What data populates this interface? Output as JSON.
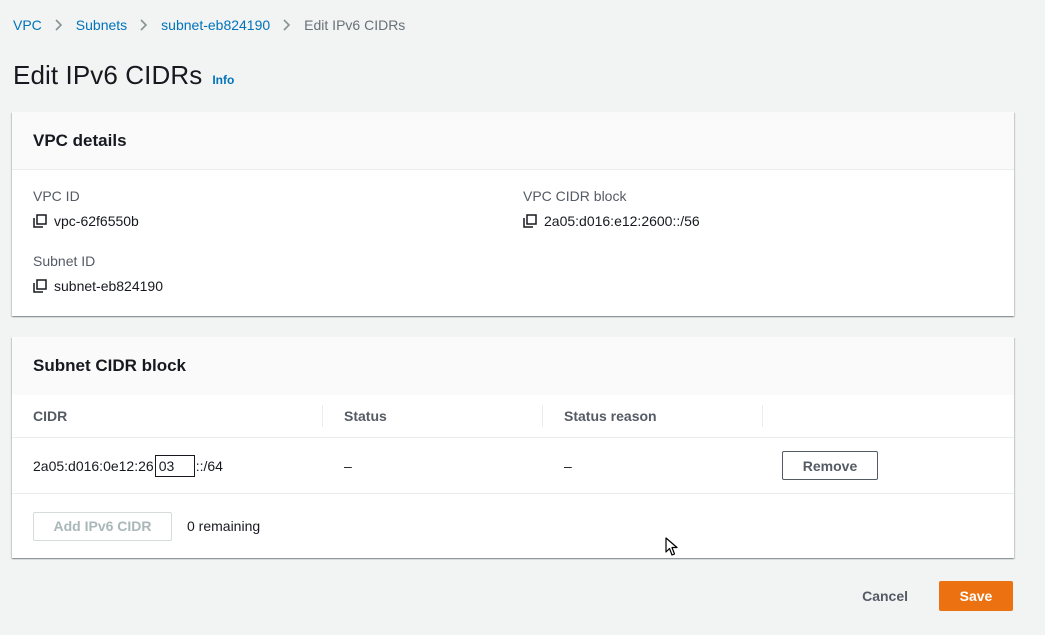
{
  "breadcrumb": {
    "items": [
      "VPC",
      "Subnets",
      "subnet-eb824190"
    ],
    "current": "Edit IPv6 CIDRs"
  },
  "page": {
    "title": "Edit IPv6 CIDRs",
    "info_label": "Info"
  },
  "vpc_details": {
    "heading": "VPC details",
    "vpc_id_label": "VPC ID",
    "vpc_id_value": "vpc-62f6550b",
    "vpc_cidr_label": "VPC CIDR block",
    "vpc_cidr_value": "2a05:d016:e12:2600::/56",
    "subnet_id_label": "Subnet ID",
    "subnet_id_value": "subnet-eb824190"
  },
  "subnet_cidr": {
    "heading": "Subnet CIDR block",
    "columns": [
      "CIDR",
      "Status",
      "Status reason",
      ""
    ],
    "row": {
      "cidr_prefix": "2a05:d016:0e12:26",
      "cidr_input": "03",
      "cidr_suffix": "::/64",
      "status": "–",
      "status_reason": "–",
      "remove_label": "Remove"
    },
    "add_label": "Add IPv6 CIDR",
    "remaining": "0 remaining"
  },
  "actions": {
    "cancel_label": "Cancel",
    "save_label": "Save"
  },
  "colors": {
    "link": "#0073bb",
    "primary_button": "#ec7211",
    "background": "#f2f3f3"
  },
  "icons": {
    "copy": "copy-icon",
    "separator": "chevron-right-icon",
    "cursor": "mouse-pointer-icon"
  }
}
